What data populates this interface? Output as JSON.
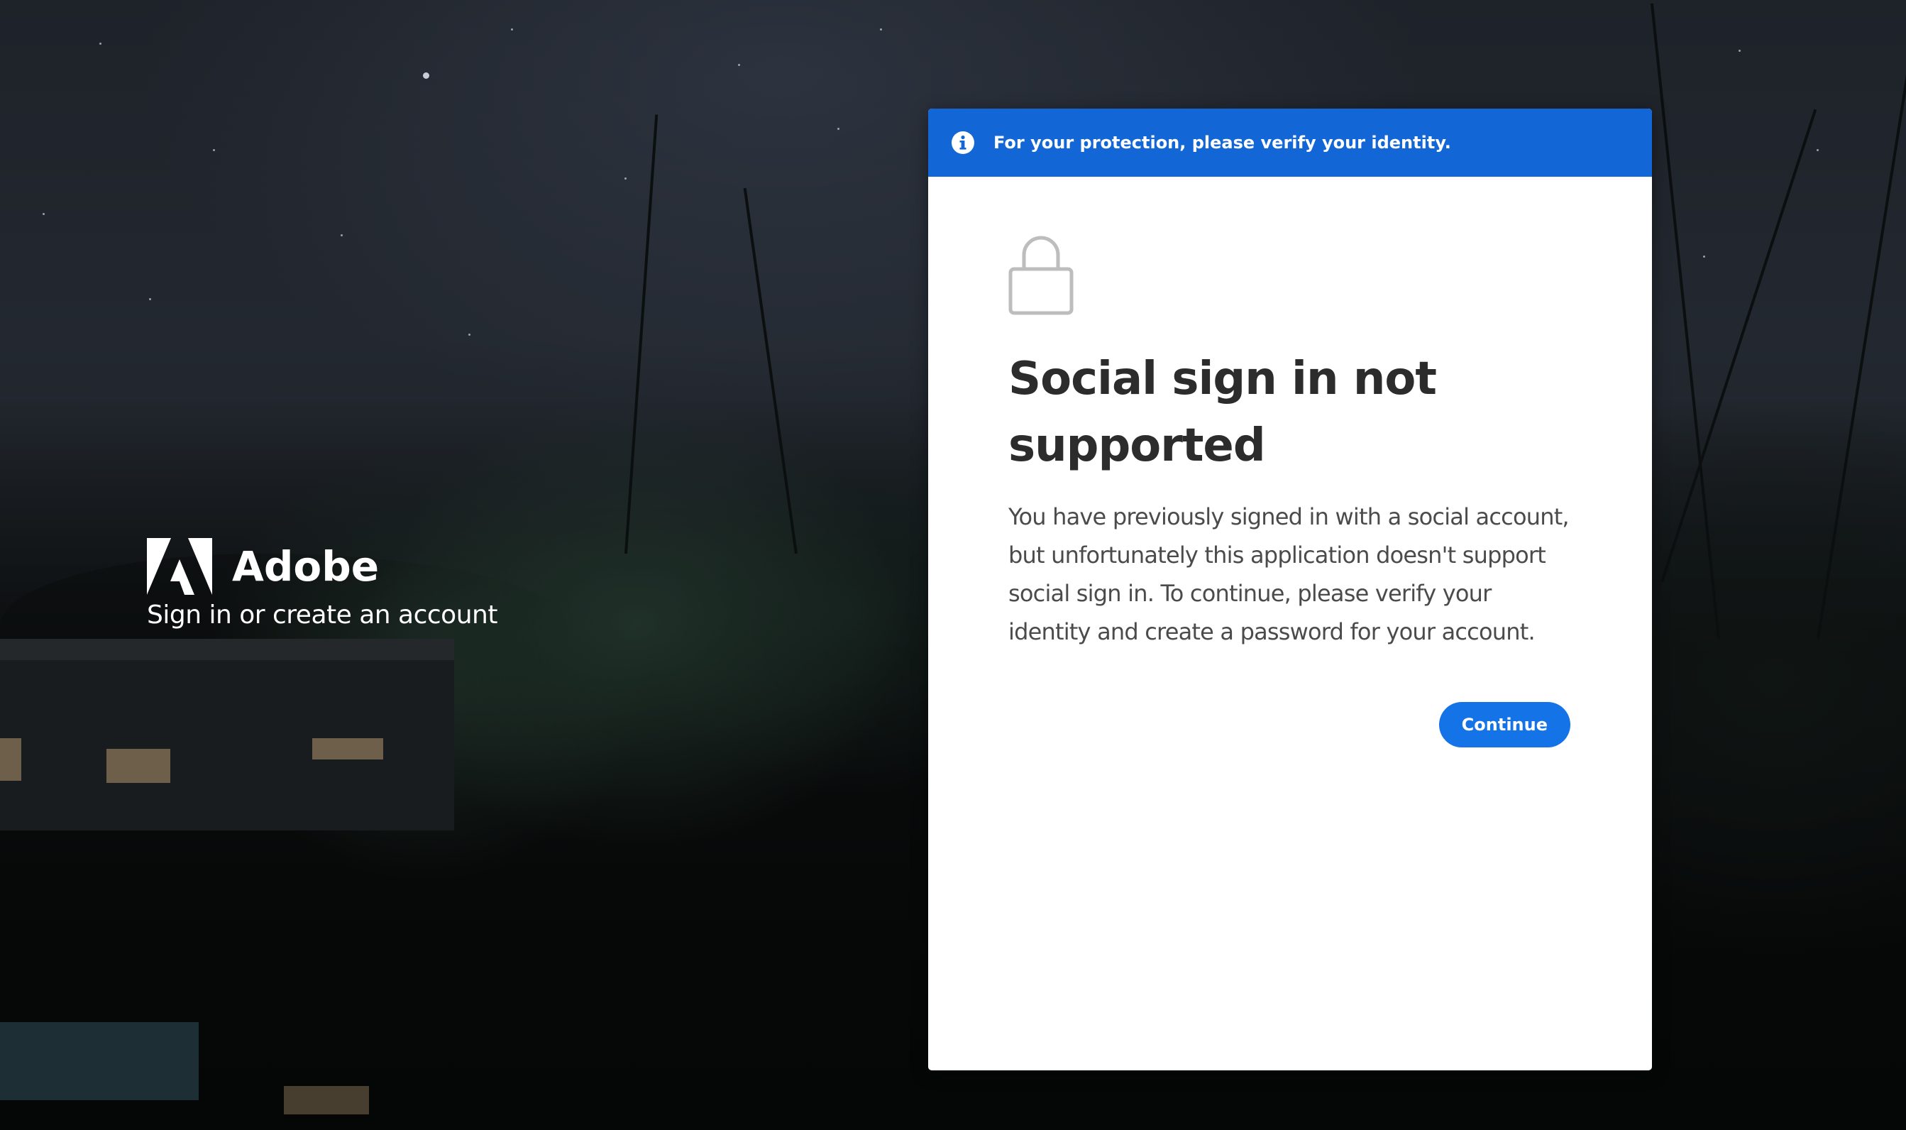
{
  "brand": {
    "name": "Adobe",
    "tagline": "Sign in or create an account",
    "logo_icon": "adobe-logo-icon"
  },
  "banner": {
    "icon": "info-icon",
    "text": "For your protection, please verify your identity.",
    "color": "#1366d6"
  },
  "dialog": {
    "icon": "lock-icon",
    "title": "Social sign in not supported",
    "message": "You have previously signed in with a social account, but unfortunately this application doesn't support social sign in. To continue, please verify your identity and create a password for your account.",
    "continue_label": "Continue",
    "button_color": "#1473e6"
  }
}
